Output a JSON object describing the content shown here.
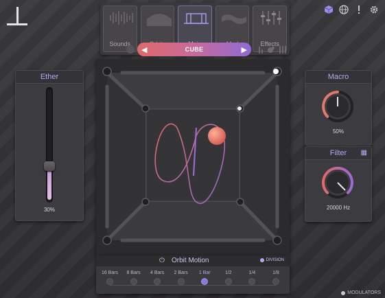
{
  "app": {
    "logo": "logo"
  },
  "top_icons": [
    "cube-view-icon",
    "globe-icon",
    "info-icon",
    "settings-gear-icon"
  ],
  "tabs": [
    {
      "label": "Sounds",
      "icon": "waveform-icon",
      "active": false
    },
    {
      "label": "Orbits",
      "icon": "orbits-icon",
      "active": false
    },
    {
      "label": "Main",
      "icon": "main-icon",
      "active": true
    },
    {
      "label": "Mod",
      "icon": "mod-icon",
      "active": false
    },
    {
      "label": "Effects",
      "icon": "effects-sliders-icon",
      "active": false
    }
  ],
  "preset": {
    "name": "CUBE",
    "prev_icon": "triangle-left-icon",
    "next_icon": "triangle-right-icon"
  },
  "ether": {
    "title": "Ether",
    "value_label": "30%",
    "value": 0.3
  },
  "macro": {
    "title": "Macro",
    "value_label": "50%",
    "value": 0.5
  },
  "filter": {
    "title": "Filter",
    "value_label": "20000 Hz",
    "value": 1.0
  },
  "orbit_motion": {
    "title": "Orbit Motion",
    "division_label": "DIVISION",
    "steps": [
      "16 Bars",
      "8 Bars",
      "4 Bars",
      "2 Bars",
      "1 Bar",
      "1/2",
      "1/4",
      "1/8"
    ],
    "active_step": 4
  },
  "footer": {
    "modulators_label": "MODULATORS"
  },
  "colors": {
    "accent": "#b6a8f2",
    "preset_gradient_start": "#e06a6a",
    "preset_gradient_end": "#8f6ad6",
    "orbit_ball": "#e8776a"
  }
}
